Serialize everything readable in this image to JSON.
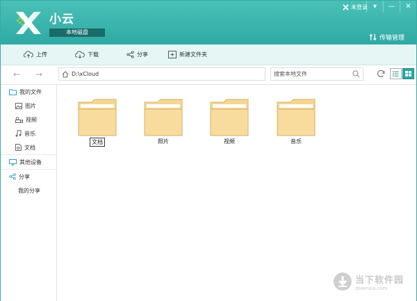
{
  "app": {
    "name": "小云",
    "subtitle": "本地磁盘",
    "login_label": "未登录",
    "transfer_label": "传输管理",
    "window_buttons": [
      "▾",
      "—",
      "✕"
    ]
  },
  "toolbar": {
    "items": [
      {
        "label": "上传",
        "icon": "upload-cloud-icon"
      },
      {
        "label": "下载",
        "icon": "download-cloud-icon"
      },
      {
        "label": "分享",
        "icon": "share-icon"
      },
      {
        "label": "新建文件夹",
        "icon": "new-folder-icon"
      }
    ]
  },
  "address": {
    "path": "D:\\xCloud",
    "search_placeholder": "搜索本地文件"
  },
  "sidebar": {
    "my_files": "我的文件",
    "items": [
      "图片",
      "视频",
      "音乐",
      "文档"
    ],
    "other_devices": "其他设备",
    "share": "分享",
    "my_share": "我的分享"
  },
  "folders": [
    "文档",
    "照片",
    "视频",
    "音乐"
  ],
  "watermark": {
    "title": "当下软件园",
    "url": "downxia.com"
  },
  "colors": {
    "header": "#2fa9a4",
    "toolbar": "#e6f6f5",
    "folder": "#f5d793",
    "folder_border": "#d9b163",
    "accent": "#2ba6a1"
  }
}
